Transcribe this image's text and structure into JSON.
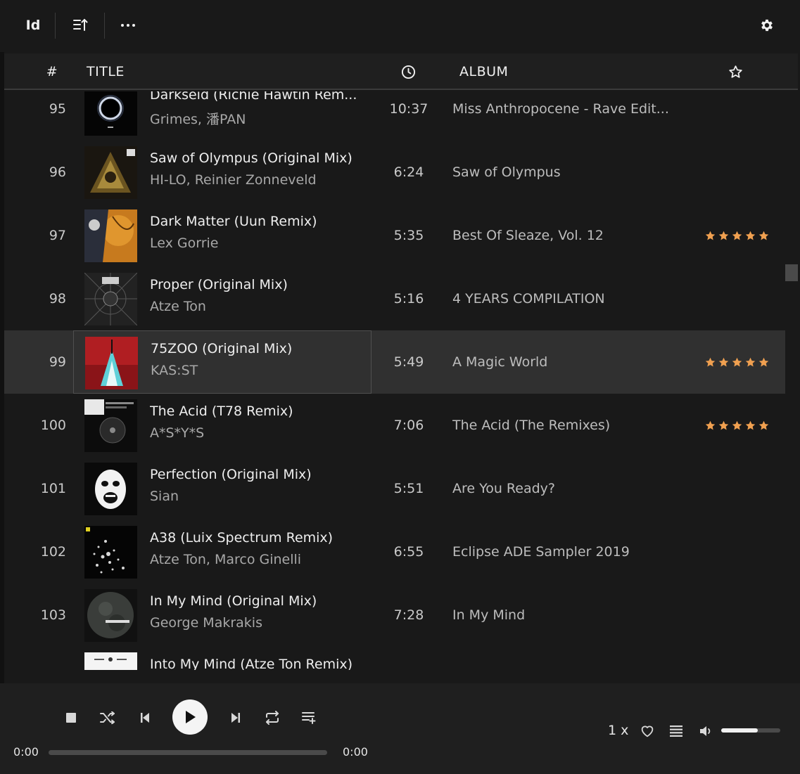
{
  "toolbar": {
    "id_label": "Id",
    "sort_icon": "sort-ascending-icon",
    "more_icon": "more-horizontal-icon",
    "settings_icon": "gear-icon"
  },
  "columns": {
    "number": "#",
    "title": "TITLE",
    "duration_icon": "clock-icon",
    "album": "ALBUM",
    "rating_icon": "star-outline-icon"
  },
  "colors": {
    "background": "#191919",
    "header_bg": "#1f1f1f",
    "selected_row": "#303030",
    "star": "#f0a050",
    "text_secondary": "#a8a8a8"
  },
  "tracks": [
    {
      "number": "95",
      "title": "Darkseid (Richie Hawtin Rem...",
      "artist": "Grimes, 潘PAN",
      "duration": "10:37",
      "album": "Miss Anthropocene - Rave Edit...",
      "rating": 0,
      "selected": false
    },
    {
      "number": "96",
      "title": "Saw of Olympus (Original Mix)",
      "artist": "HI-LO, Reinier Zonneveld",
      "duration": "6:24",
      "album": "Saw of Olympus",
      "rating": 0,
      "selected": false
    },
    {
      "number": "97",
      "title": "Dark Matter (Uun Remix)",
      "artist": "Lex Gorrie",
      "duration": "5:35",
      "album": "Best Of Sleaze, Vol. 12",
      "rating": 5,
      "selected": false
    },
    {
      "number": "98",
      "title": "Proper (Original Mix)",
      "artist": "Atze Ton",
      "duration": "5:16",
      "album": "4 YEARS COMPILATION",
      "rating": 0,
      "selected": false
    },
    {
      "number": "99",
      "title": "75ZOO (Original Mix)",
      "artist": "KAS:ST",
      "duration": "5:49",
      "album": "A Magic World",
      "rating": 5,
      "selected": true
    },
    {
      "number": "100",
      "title": "The Acid (T78 Remix)",
      "artist": "A*S*Y*S",
      "duration": "7:06",
      "album": "The Acid (The Remixes)",
      "rating": 5,
      "selected": false
    },
    {
      "number": "101",
      "title": "Perfection (Original Mix)",
      "artist": "Sian",
      "duration": "5:51",
      "album": "Are You Ready?",
      "rating": 0,
      "selected": false
    },
    {
      "number": "102",
      "title": "A38 (Luix Spectrum Remix)",
      "artist": "Atze Ton, Marco Ginelli",
      "duration": "6:55",
      "album": "Eclipse ADE Sampler 2019",
      "rating": 0,
      "selected": false
    },
    {
      "number": "103",
      "title": "In My Mind (Original Mix)",
      "artist": "George Makrakis",
      "duration": "7:28",
      "album": "In My Mind",
      "rating": 0,
      "selected": false
    },
    {
      "number": "",
      "title": "Into My Mind (Atze Ton Remix)",
      "artist": "",
      "duration": "",
      "album": "",
      "rating": 0,
      "selected": false
    }
  ],
  "player": {
    "current_time": "0:00",
    "total_time": "0:00",
    "progress": 0,
    "speed": "1 x",
    "volume": 0.62,
    "icons": [
      "stop-icon",
      "shuffle-icon",
      "previous-icon",
      "play-icon",
      "next-icon",
      "repeat-icon",
      "queue-icon",
      "heart-icon",
      "playlist-icon",
      "volume-icon"
    ]
  }
}
